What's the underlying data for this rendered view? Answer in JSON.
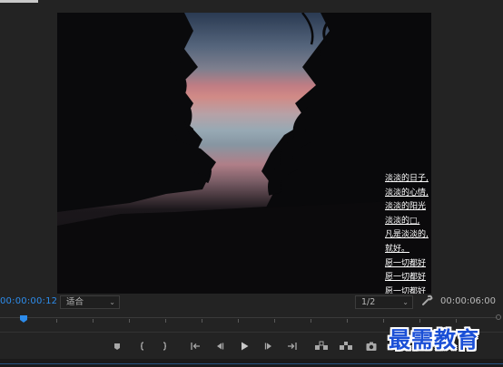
{
  "monitor": {
    "current_timecode": "00:00:00:12",
    "duration_timecode": "00:00:06:00",
    "fit_label": "适合",
    "resolution_label": "1/2"
  },
  "subtitles": {
    "lines": [
      "淡淡的日子,",
      "淡淡的心情,",
      "淡淡的阳光",
      "淡淡的□,",
      "凡是淡淡的,",
      "就好。",
      "愿一切都好",
      "愿一切都好",
      "愿一切都好"
    ]
  },
  "transport": {
    "buttons": [
      "add-marker",
      "mark-in",
      "mark-out",
      "go-to-in",
      "step-back",
      "play",
      "step-forward",
      "go-to-out",
      "lift",
      "extract",
      "export-frame"
    ]
  },
  "watermark": {
    "text": "最需教育"
  },
  "colors": {
    "timecode_accent": "#2d8ceb",
    "watermark": "#1a4fd6",
    "panel_bg": "#232323"
  }
}
